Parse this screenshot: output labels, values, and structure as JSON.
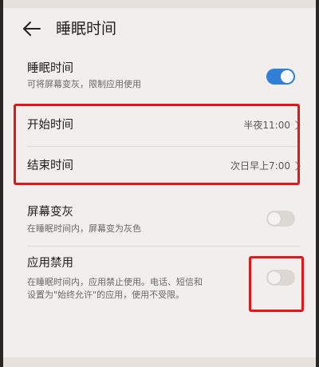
{
  "header": {
    "title": "睡眠时间"
  },
  "settings": {
    "sleep_time": {
      "title": "睡眠时间",
      "subtitle": "可将屏幕变灰，限制应用使用",
      "enabled": true
    },
    "start_time": {
      "title": "开始时间",
      "value": "半夜11:00"
    },
    "end_time": {
      "title": "结束时间",
      "value": "次日早上7:00"
    },
    "grayscale": {
      "title": "屏幕变灰",
      "subtitle": "在睡眠时间内，屏幕变为灰色",
      "enabled": false
    },
    "app_block": {
      "title": "应用禁用",
      "subtitle_line1": "在睡眠时间内，应用禁止使用。电话、短信和",
      "subtitle_line2": "设置为\"始终允许\"的应用，使用不受限。",
      "enabled": false
    }
  },
  "colors": {
    "background": "#f1eeeb",
    "toggle_on": "#2f7fd8",
    "annotation": "#e8141a"
  }
}
